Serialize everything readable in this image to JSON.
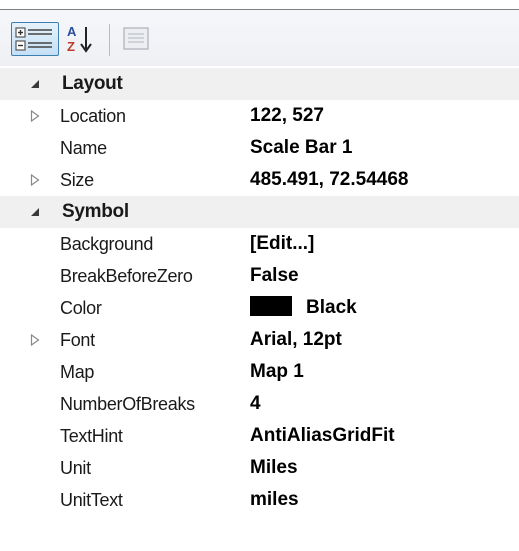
{
  "toolbar": {
    "categorized_icon": "categorized-icon",
    "alphabetical_icon": "sort-alphabetical-icon",
    "property_pages_icon": "property-pages-icon",
    "accent": "#3c7fb1"
  },
  "grid": {
    "categories": [
      {
        "label": "Layout",
        "expanded": true,
        "properties": [
          {
            "name": "Location",
            "value": "122, 527",
            "expandable": true
          },
          {
            "name": "Name",
            "value": "Scale Bar 1",
            "expandable": false
          },
          {
            "name": "Size",
            "value": "485.491, 72.54468",
            "expandable": true
          }
        ]
      },
      {
        "label": "Symbol",
        "expanded": true,
        "properties": [
          {
            "name": "Background",
            "value": "[Edit...]",
            "expandable": false
          },
          {
            "name": "BreakBeforeZero",
            "value": "False",
            "expandable": false
          },
          {
            "name": "Color",
            "value": "Black",
            "expandable": false,
            "swatch": "#000000"
          },
          {
            "name": "Font",
            "value": "Arial, 12pt",
            "expandable": true
          },
          {
            "name": "Map",
            "value": "Map 1",
            "expandable": false
          },
          {
            "name": "NumberOfBreaks",
            "value": "4",
            "expandable": false
          },
          {
            "name": "TextHint",
            "value": "AntiAliasGridFit",
            "expandable": false
          },
          {
            "name": "Unit",
            "value": "Miles",
            "expandable": false
          },
          {
            "name": "UnitText",
            "value": "miles",
            "expandable": false
          }
        ]
      }
    ]
  },
  "colors": {
    "category_row": "#f0f0f0",
    "expanded_glyph": "#3a3a3a",
    "collapsed_glyph": "#8a8a8a"
  }
}
